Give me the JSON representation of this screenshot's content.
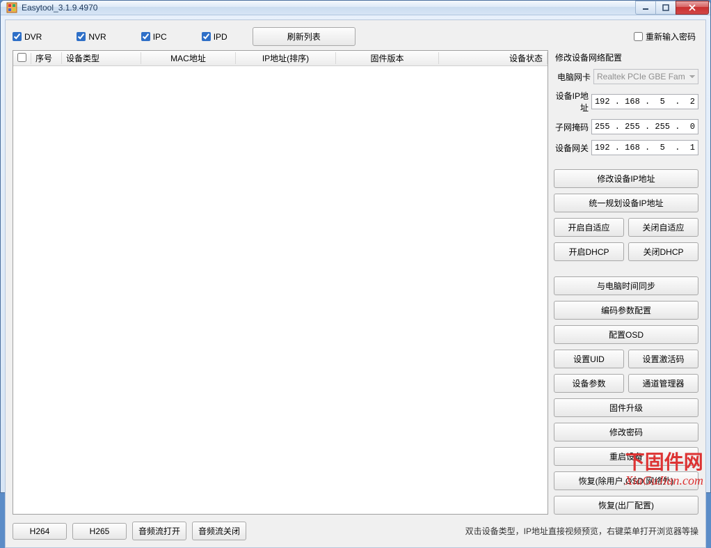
{
  "window": {
    "title": "Easytool_3.1.9.4970"
  },
  "filters": {
    "dvr": "DVR",
    "nvr": "NVR",
    "ipc": "IPC",
    "ipd": "IPD",
    "refresh": "刷新列表",
    "reenter_password": "重新输入密码"
  },
  "table": {
    "headers": {
      "seq": "序号",
      "type": "设备类型",
      "mac": "MAC地址",
      "ip": "IP地址(排序)",
      "fw": "固件版本",
      "status": "设备状态"
    }
  },
  "side": {
    "title": "修改设备网络配置",
    "nic_label": "电脑网卡",
    "nic_value": "Realtek PCIe GBE Fam",
    "ip_label": "设备IP地址",
    "ip_value": "192 . 168 .  5  .  2",
    "mask_label": "子网掩码",
    "mask_value": "255 . 255 . 255 .  0",
    "gw_label": "设备网关",
    "gw_value": "192 . 168 .  5  .  1",
    "buttons": {
      "modify_ip": "修改设备IP地址",
      "plan_ip": "统一规划设备IP地址",
      "auto_on": "开启自适应",
      "auto_off": "关闭自适应",
      "dhcp_on": "开启DHCP",
      "dhcp_off": "关闭DHCP",
      "time_sync": "与电脑时间同步",
      "enc_param": "编码参数配置",
      "osd": "配置OSD",
      "set_uid": "设置UID",
      "set_act": "设置激活码",
      "dev_param": "设备参数",
      "ch_mgr": "通道管理器",
      "fw_upgrade": "固件升级",
      "chg_pwd": "修改密码",
      "reboot": "重启设备",
      "restore_except": "恢复(除用户,OSD,网络外)",
      "restore_factory": "恢复(出厂配置)"
    }
  },
  "bottom": {
    "h264": "H264",
    "h265": "H265",
    "audio_on": "音频流打开",
    "audio_off": "音频流关闭",
    "hint": "双击设备类型，IP地址直接视频预览，右键菜单打开浏览器等操"
  },
  "watermark": {
    "line1": "下固件网",
    "line2": "XiaGuJian.com"
  }
}
